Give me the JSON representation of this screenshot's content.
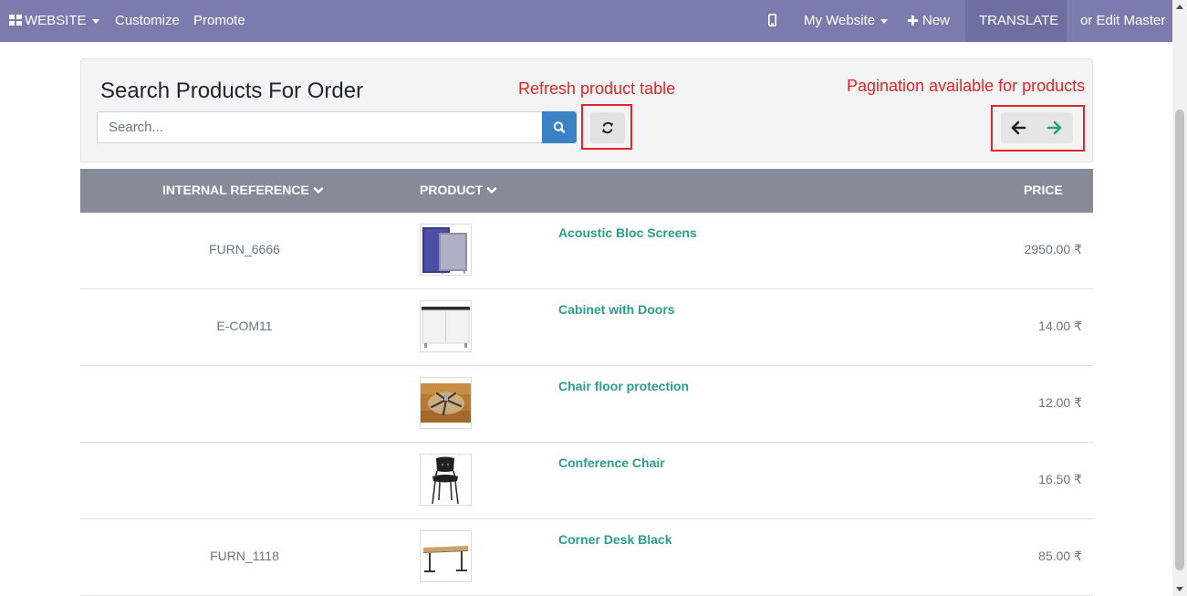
{
  "navbar": {
    "website_label": "WEBSITE",
    "customize_label": "Customize",
    "promote_label": "Promote",
    "my_website_label": "My Website",
    "new_label": "New",
    "translate_label": "TRANSLATE",
    "edit_master_label": "or Edit Master"
  },
  "search_panel": {
    "title": "Search Products For Order",
    "search_placeholder": "Search...",
    "refresh_annotation": "Refresh product table",
    "pagination_annotation": "Pagination available for products"
  },
  "table": {
    "headers": {
      "internal_reference": "INTERNAL REFERENCE",
      "product": "PRODUCT",
      "price": "PRICE"
    },
    "rows": [
      {
        "ref": "FURN_6666",
        "name": "Acoustic Bloc Screens",
        "price": "2950.00 ₹",
        "image": "acoustic-screens-image"
      },
      {
        "ref": "E-COM11",
        "name": "Cabinet with Doors",
        "price": "14.00 ₹",
        "image": "cabinet-image"
      },
      {
        "ref": "",
        "name": "Chair floor protection",
        "price": "12.00 ₹",
        "image": "chair-floor-protection-image"
      },
      {
        "ref": "",
        "name": "Conference Chair",
        "price": "16.50 ₹",
        "image": "conference-chair-image"
      },
      {
        "ref": "FURN_1118",
        "name": "Corner Desk Black",
        "price": "85.00 ₹",
        "image": "corner-desk-image"
      }
    ]
  },
  "colors": {
    "navbar_bg": "#7c7bad",
    "table_header_bg": "#868a99",
    "product_link": "#2a9d8f",
    "search_button": "#3a82c4",
    "annotation_red": "#e0262a"
  }
}
